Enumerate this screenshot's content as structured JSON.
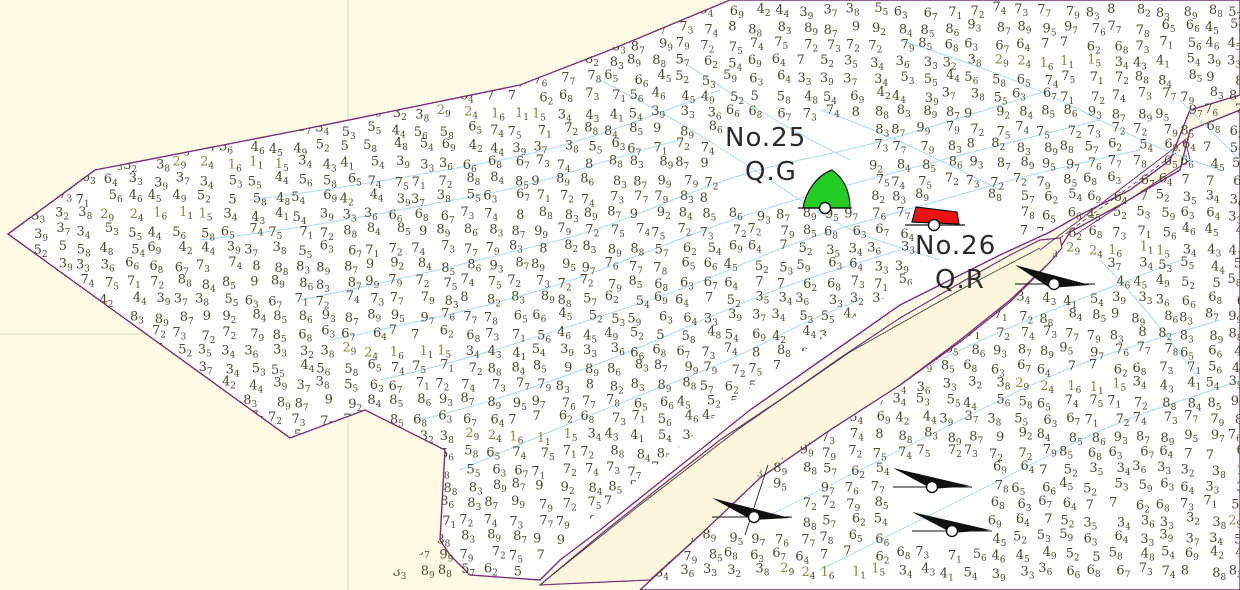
{
  "map": {
    "colors": {
      "land": "#fdfbe6",
      "water": "#ffffff",
      "shore": "#7a2f7a",
      "contour": "#a8d8ee",
      "grid": "#d8d8b8",
      "starboard_buoy": "#22cc22",
      "port_buoy": "#ee1111",
      "sounding": "#4a4a2e"
    },
    "buoys": [
      {
        "name": "No.25",
        "light": "Q.G",
        "icon": "green-starboard-buoy-icon"
      },
      {
        "name": "No.26",
        "light": "Q.R",
        "icon": "red-port-buoy-icon"
      }
    ],
    "soundings": [
      [
        "7",
        "2"
      ],
      [
        "7",
        "5"
      ],
      [
        "7",
        "4"
      ],
      [
        "7",
        "5"
      ],
      [
        "7",
        "2"
      ],
      [
        "7",
        "3"
      ],
      [
        "7",
        "2"
      ],
      [
        "7",
        "2"
      ],
      [
        "7",
        "9"
      ],
      [
        "8",
        "5"
      ],
      [
        "6",
        "8"
      ],
      [
        "6",
        "3"
      ],
      [
        "6",
        "7"
      ],
      [
        "6",
        "4"
      ],
      [
        "7",
        ""
      ],
      [
        "7",
        ""
      ],
      [
        "6",
        "2"
      ],
      [
        "6",
        "8"
      ],
      [
        "7",
        "3"
      ],
      [
        "7",
        "1"
      ],
      [
        "5",
        "6"
      ],
      [
        "4",
        "6"
      ],
      [
        "4",
        "5"
      ],
      [
        "4",
        "9"
      ],
      [
        "5",
        "2"
      ],
      [
        "5",
        ""
      ],
      [
        "5",
        "8"
      ],
      [
        "4",
        "8"
      ],
      [
        "5",
        "4"
      ],
      [
        "6",
        "9"
      ],
      [
        "4",
        "2"
      ],
      [
        "4",
        "4"
      ],
      [
        "3",
        "9"
      ],
      [
        "3",
        "7"
      ],
      [
        "3",
        "8"
      ],
      [
        "5",
        "5"
      ],
      [
        "6",
        "3"
      ],
      [
        "6",
        "7"
      ],
      [
        "7",
        "1"
      ],
      [
        "7",
        "2"
      ],
      [
        "7",
        "4"
      ],
      [
        "7",
        "3"
      ],
      [
        "7",
        "7"
      ],
      [
        "7",
        "9"
      ],
      [
        "8",
        "3"
      ],
      [
        "8",
        ""
      ],
      [
        "8",
        "2"
      ],
      [
        "8",
        "3"
      ],
      [
        "8",
        "9"
      ],
      [
        "8",
        "8"
      ],
      [
        "5",
        "7"
      ],
      [
        "6",
        "2"
      ],
      [
        "5",
        "4"
      ],
      [
        "6",
        "9"
      ],
      [
        "6",
        "4"
      ],
      [
        "7",
        ""
      ],
      [
        "5",
        "2"
      ],
      [
        "3",
        "5"
      ],
      [
        "3",
        "4"
      ],
      [
        "3",
        "6"
      ],
      [
        "3",
        "3"
      ],
      [
        "3",
        "2"
      ],
      [
        "3",
        "8"
      ],
      [
        "2",
        "9"
      ],
      [
        "2",
        "4"
      ],
      [
        "1",
        "6"
      ],
      [
        "1",
        "1"
      ],
      [
        "1",
        "5"
      ],
      [
        "3",
        "4"
      ],
      [
        "4",
        "3"
      ],
      [
        "4",
        "1"
      ],
      [
        "5",
        "4"
      ],
      [
        "3",
        "9"
      ],
      [
        "3",
        "3"
      ],
      [
        "3",
        "6"
      ],
      [
        "6",
        "6"
      ],
      [
        "6",
        "8"
      ],
      [
        "6",
        "7"
      ],
      [
        "7",
        "3"
      ],
      [
        "7",
        "4"
      ],
      [
        "8",
        ""
      ],
      [
        "8",
        "8"
      ],
      [
        "8",
        "3"
      ],
      [
        "8",
        "9"
      ],
      [
        "8",
        "7"
      ],
      [
        "9",
        ""
      ],
      [
        "9",
        "2"
      ],
      [
        "8",
        "4"
      ],
      [
        "8",
        "5"
      ],
      [
        "8",
        "6"
      ],
      [
        "9",
        "3"
      ],
      [
        "8",
        "7"
      ],
      [
        "8",
        "9"
      ],
      [
        "9",
        "5"
      ],
      [
        "9",
        "7"
      ],
      [
        "7",
        "6"
      ],
      [
        "7",
        "7"
      ],
      [
        "7",
        "8"
      ],
      [
        "6",
        "5"
      ],
      [
        "6",
        "6"
      ],
      [
        "4",
        "5"
      ],
      [
        "5",
        "2"
      ],
      [
        "5",
        "3"
      ],
      [
        "5",
        "9"
      ],
      [
        "6",
        "3"
      ],
      [
        "6",
        "4"
      ],
      [
        "3",
        "3"
      ],
      [
        "3",
        "9"
      ],
      [
        "3",
        "7"
      ],
      [
        "3",
        "4"
      ],
      [
        "5",
        "3"
      ],
      [
        "5",
        "5"
      ],
      [
        "4",
        "4"
      ],
      [
        "5",
        "6"
      ],
      [
        "5",
        "8"
      ],
      [
        "6",
        "5"
      ],
      [
        "7",
        "4"
      ],
      [
        "7",
        "5"
      ],
      [
        "7",
        "1"
      ],
      [
        "7",
        "2"
      ],
      [
        "8",
        "8"
      ],
      [
        "8",
        "4"
      ],
      [
        "8",
        "5"
      ],
      [
        "9",
        ""
      ],
      [
        "8",
        "9"
      ],
      [
        "8",
        "6"
      ],
      [
        "8",
        "3"
      ],
      [
        "8",
        "7"
      ],
      [
        "9",
        "9"
      ],
      [
        "7",
        "9"
      ]
    ]
  }
}
